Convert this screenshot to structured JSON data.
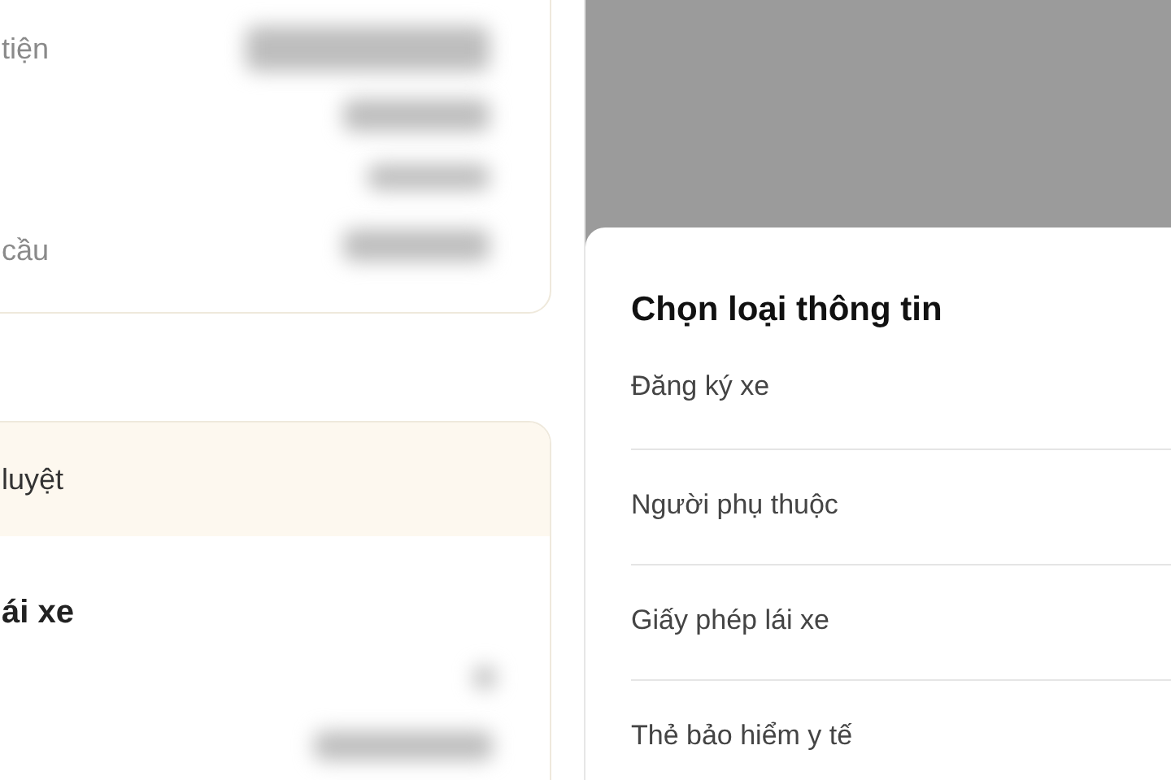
{
  "left_screen": {
    "info_card": {
      "rows": [
        {
          "label": "tiện"
        },
        {
          "label": "cầu"
        }
      ]
    },
    "license_card": {
      "status": "luyệt",
      "title": "ái xe"
    }
  },
  "right_screen": {
    "sheet": {
      "title": "Chọn loại thông tin",
      "options": [
        {
          "label": "Đăng ký xe"
        },
        {
          "label": "Người phụ thuộc"
        },
        {
          "label": "Giấy phép lái xe"
        },
        {
          "label": "Thẻ bảo hiểm y tế"
        }
      ]
    }
  }
}
